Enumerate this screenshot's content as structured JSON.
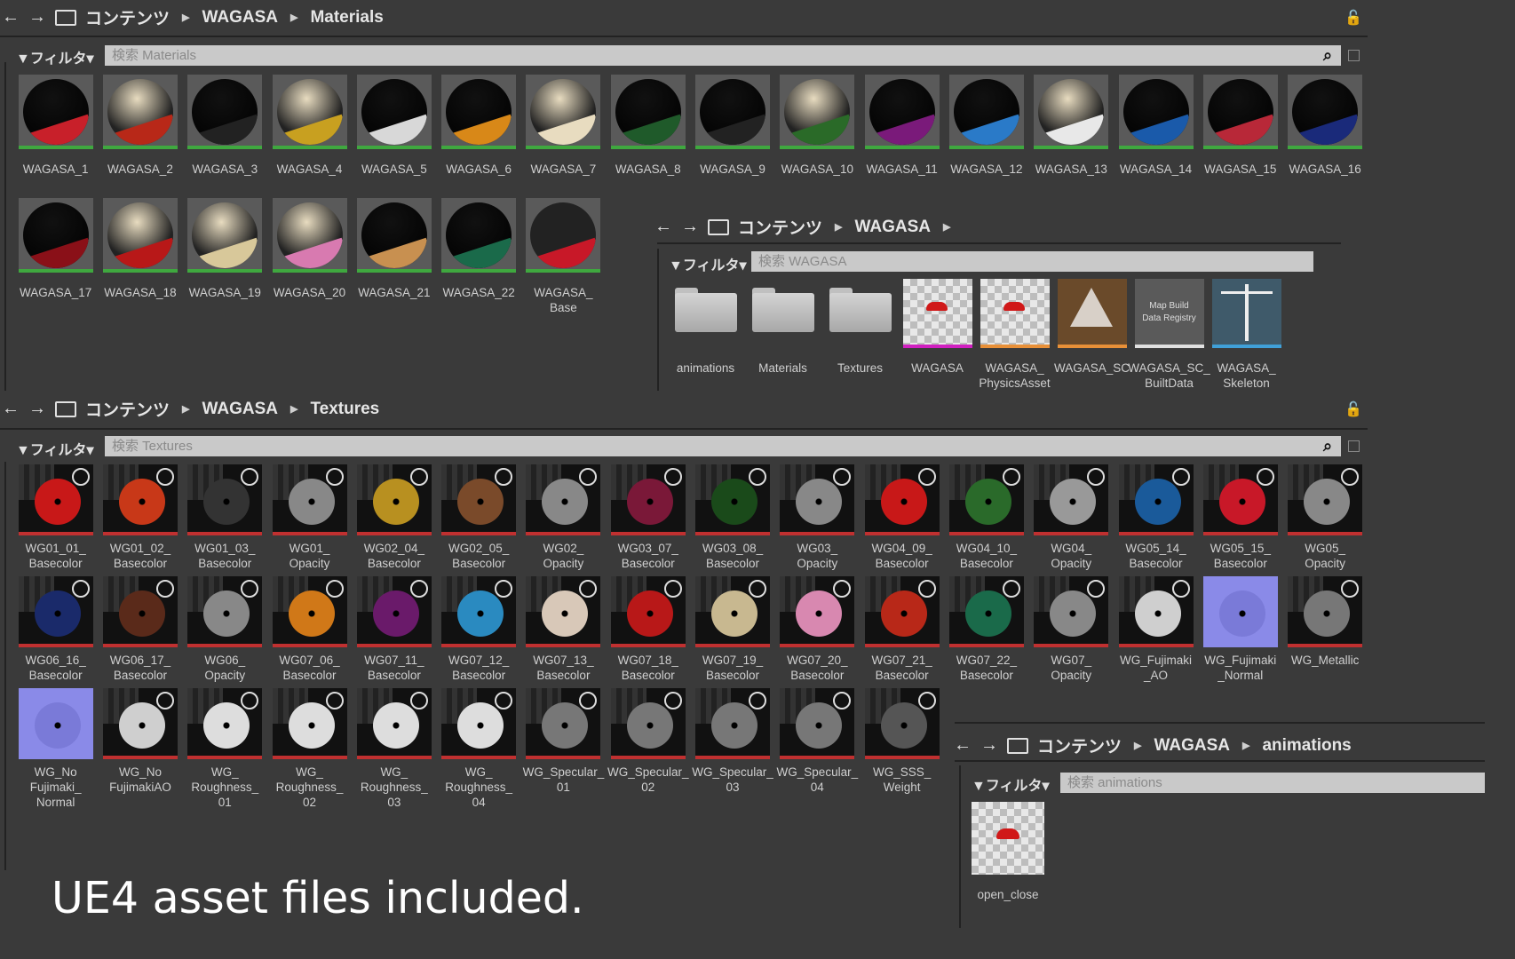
{
  "materials_panel": {
    "breadcrumb": [
      "コンテンツ",
      "WAGASA",
      "Materials"
    ],
    "filter_label": "▼フィルタ▾",
    "search_placeholder": "検索 Materials",
    "items": [
      {
        "label": "WAGASA_1",
        "top": "#111",
        "band": "#c8202a"
      },
      {
        "label": "WAGASA_2",
        "top": "#e8dcc0",
        "band": "#b82818"
      },
      {
        "label": "WAGASA_3",
        "top": "#111",
        "band": "#222"
      },
      {
        "label": "WAGASA_4",
        "top": "#e8dcc0",
        "band": "#c8a020"
      },
      {
        "label": "WAGASA_5",
        "top": "#111",
        "band": "#d8d8d8"
      },
      {
        "label": "WAGASA_6",
        "top": "#111",
        "band": "#d88818"
      },
      {
        "label": "WAGASA_7",
        "top": "#e8dcc0",
        "band": "#e8dcc0"
      },
      {
        "label": "WAGASA_8",
        "top": "#111",
        "band": "#1f5a2a"
      },
      {
        "label": "WAGASA_9",
        "top": "#111",
        "band": "#222"
      },
      {
        "label": "WAGASA_10",
        "top": "#e8dcc0",
        "band": "#2a6a28"
      },
      {
        "label": "WAGASA_11",
        "top": "#111",
        "band": "#7a1a7a"
      },
      {
        "label": "WAGASA_12",
        "top": "#111",
        "band": "#2a7ac8"
      },
      {
        "label": "WAGASA_13",
        "top": "#e8dcc0",
        "band": "#e8e8e8"
      },
      {
        "label": "WAGASA_14",
        "top": "#111",
        "band": "#1a5aaa"
      },
      {
        "label": "WAGASA_15",
        "top": "#111",
        "band": "#b82838"
      },
      {
        "label": "WAGASA_16",
        "top": "#111",
        "band": "#1a2a7a"
      },
      {
        "label": "WAGASA_17",
        "top": "#111",
        "band": "#8a1018"
      },
      {
        "label": "WAGASA_18",
        "top": "#e8dcc0",
        "band": "#b81818"
      },
      {
        "label": "WAGASA_19",
        "top": "#e8dcc0",
        "band": "#d8c89a"
      },
      {
        "label": "WAGASA_20",
        "top": "#e8dcc0",
        "band": "#d87ab0"
      },
      {
        "label": "WAGASA_21",
        "top": "#111",
        "band": "#c89050"
      },
      {
        "label": "WAGASA_22",
        "top": "#111",
        "band": "#1a6a4a"
      },
      {
        "label": "WAGASA_\nBase",
        "top": "#222",
        "band": "#c81828"
      }
    ]
  },
  "wagasa_panel": {
    "breadcrumb": [
      "コンテンツ",
      "WAGASA"
    ],
    "filter_label": "▼フィルタ▾",
    "search_placeholder": "検索 WAGASA",
    "items": [
      {
        "label": "animations",
        "kind": "folder"
      },
      {
        "label": "Materials",
        "kind": "folder"
      },
      {
        "label": "Textures",
        "kind": "folder"
      },
      {
        "label": "WAGASA",
        "kind": "mesh",
        "bar": "#d020c0"
      },
      {
        "label": "WAGASA_\nPhysicsAsset",
        "kind": "mesh",
        "bar": "#e89038"
      },
      {
        "label": "WAGASA_SC",
        "kind": "sc",
        "bar": "#e89038"
      },
      {
        "label": "WAGASA_SC_\nBuiltData",
        "kind": "builtdata",
        "bar": "#e0e0e0",
        "text": "Map Build\nData Registry"
      },
      {
        "label": "WAGASA_\nSkeleton",
        "kind": "skeleton",
        "bar": "#40a0d8"
      }
    ]
  },
  "textures_panel": {
    "breadcrumb": [
      "コンテンツ",
      "WAGASA",
      "Textures"
    ],
    "filter_label": "▼フィルタ▾",
    "search_placeholder": "検索 Textures",
    "items": [
      {
        "label": "WG01_01_\nBasecolor",
        "disc": "#c81818"
      },
      {
        "label": "WG01_02_\nBasecolor",
        "disc": "#c83818"
      },
      {
        "label": "WG01_03_\nBasecolor",
        "disc": "#333"
      },
      {
        "label": "WG01_\nOpacity",
        "disc": "#888"
      },
      {
        "label": "WG02_04_\nBasecolor",
        "disc": "#b89020"
      },
      {
        "label": "WG02_05_\nBasecolor",
        "disc": "#7a4a2a"
      },
      {
        "label": "WG02_\nOpacity",
        "disc": "#888"
      },
      {
        "label": "WG03_07_\nBasecolor",
        "disc": "#7a1838"
      },
      {
        "label": "WG03_08_\nBasecolor",
        "disc": "#1a4a1a"
      },
      {
        "label": "WG03_\nOpacity",
        "disc": "#888"
      },
      {
        "label": "WG04_09_\nBasecolor",
        "disc": "#c81818"
      },
      {
        "label": "WG04_10_\nBasecolor",
        "disc": "#2a6a2a"
      },
      {
        "label": "WG04_\nOpacity",
        "disc": "#999"
      },
      {
        "label": "WG05_14_\nBasecolor",
        "disc": "#1a5a9a"
      },
      {
        "label": "WG05_15_\nBasecolor",
        "disc": "#c81828"
      },
      {
        "label": "WG05_\nOpacity",
        "disc": "#888"
      },
      {
        "label": "WG06_16_\nBasecolor",
        "disc": "#1a2a6a"
      },
      {
        "label": "WG06_17_\nBasecolor",
        "disc": "#5a2a1a"
      },
      {
        "label": "WG06_\nOpacity",
        "disc": "#888"
      },
      {
        "label": "WG07_06_\nBasecolor",
        "disc": "#d07818"
      },
      {
        "label": "WG07_11_\nBasecolor",
        "disc": "#6a1a6a"
      },
      {
        "label": "WG07_12_\nBasecolor",
        "disc": "#2a8ac0"
      },
      {
        "label": "WG07_13_\nBasecolor",
        "disc": "#d8c8b8"
      },
      {
        "label": "WG07_18_\nBasecolor",
        "disc": "#b81818"
      },
      {
        "label": "WG07_19_\nBasecolor",
        "disc": "#c8b890"
      },
      {
        "label": "WG07_20_\nBasecolor",
        "disc": "#d888b0"
      },
      {
        "label": "WG07_21_\nBasecolor",
        "disc": "#b82818"
      },
      {
        "label": "WG07_22_\nBasecolor",
        "disc": "#1a6a4a"
      },
      {
        "label": "WG07_\nOpacity",
        "disc": "#888"
      },
      {
        "label": "WG_Fujimaki\n_AO",
        "disc": "#cfcfcf"
      },
      {
        "label": "WG_Fujimaki\n_Normal",
        "disc": "#7a7ad8"
      },
      {
        "label": "WG_Metallic",
        "disc": "#777"
      },
      {
        "label": "WG_No\nFujimaki_\nNormal",
        "disc": "#7a7ad8"
      },
      {
        "label": "WG_No\nFujimakiAO",
        "disc": "#cfcfcf"
      },
      {
        "label": "WG_\nRoughness_\n01",
        "disc": "#ddd"
      },
      {
        "label": "WG_\nRoughness_\n02",
        "disc": "#ddd"
      },
      {
        "label": "WG_\nRoughness_\n03",
        "disc": "#ddd"
      },
      {
        "label": "WG_\nRoughness_\n04",
        "disc": "#ddd"
      },
      {
        "label": "WG_Specular_\n01",
        "disc": "#777"
      },
      {
        "label": "WG_Specular_\n02",
        "disc": "#777"
      },
      {
        "label": "WG_Specular_\n03",
        "disc": "#777"
      },
      {
        "label": "WG_Specular_\n04",
        "disc": "#777"
      },
      {
        "label": "WG_SSS_\nWeight",
        "disc": "#555"
      }
    ]
  },
  "animations_panel": {
    "breadcrumb": [
      "コンテンツ",
      "WAGASA",
      "animations"
    ],
    "filter_label": "▼フィルタ▾",
    "search_placeholder": "検索 animations",
    "items": [
      {
        "label": "open_close"
      }
    ]
  },
  "overlay_text": "UE4 asset files included."
}
